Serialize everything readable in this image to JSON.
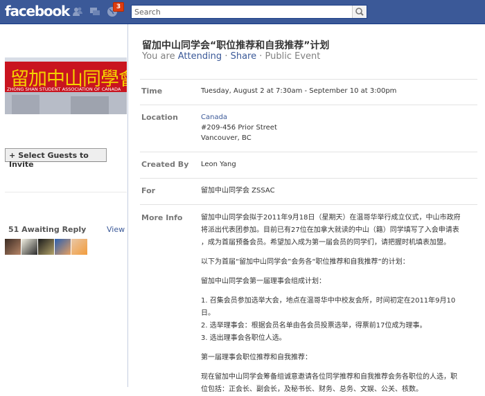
{
  "topbar": {
    "logo": "facebook",
    "notif_count": "3",
    "search_placeholder": "Search",
    "colors": {
      "bar": "#3b5998",
      "badge": "#dd3c10"
    }
  },
  "sidebar": {
    "photo_banner_text": "留加中山同學會",
    "photo_caption": "ZHONG SHAN STUDENT ASSOCIATION OF CANADA",
    "select_guests_label": "Select Guests to Invite",
    "awaiting_title": "51 Awaiting Reply",
    "awaiting_view": "View"
  },
  "event": {
    "title": "留加中山同学会“职位推荐和自我推荐”计划",
    "subtitle_prefix": "You are",
    "attending": "Attending",
    "sep": "·",
    "share": "Share",
    "privacy": "Public Event",
    "time_label": "Time",
    "time_value": "Tuesday, August 2 at 7:30am - September 10 at 3:00pm",
    "location_label": "Location",
    "location_city": "Canada",
    "location_line1": "#209-456 Prior Street",
    "location_line2": "Vancouver, BC",
    "created_label": "Created By",
    "created_value": "Leon Yang",
    "for_label": "For",
    "for_value": "留加中山同学会 ZSSAC",
    "more_label": "More Info",
    "more_info": [
      "留加中山同学会拟于2011年9月18日（星期天）在温哥华举行成立仪式，中山市政府",
      "将派出代表团参加。目前已有27位在加拿大就读的中山（籍）同学填写了入会申请表",
      "，成为首届预备会员。希望加入成为第一届会员的同学们，请把握时机填表加盟。",
      "",
      "以下为首届“留加中山同学会”会务各“职位推荐和自我推荐”的计划：",
      "",
      "留加中山同学会第一届理事会组成计划：",
      "",
      "1. 召集会员参加选举大会，地点在温哥华中中校友会所，时间初定在2011年9月10",
      "日。",
      "2. 选举理事会：根据会员名单由各会员投票选举，得票前17位成为理事。",
      "3. 选出理事会各职位人选。",
      "",
      "第一届理事会职位推荐和自我推荐：",
      "",
      "现在留加中山同学会筹备组诚意邀请各位同学推荐和自我推荐会务各职位的人选，职",
      "位包括：正会长、副会长，及秘书长、财务、总务、文娱、公关、核数。"
    ]
  }
}
